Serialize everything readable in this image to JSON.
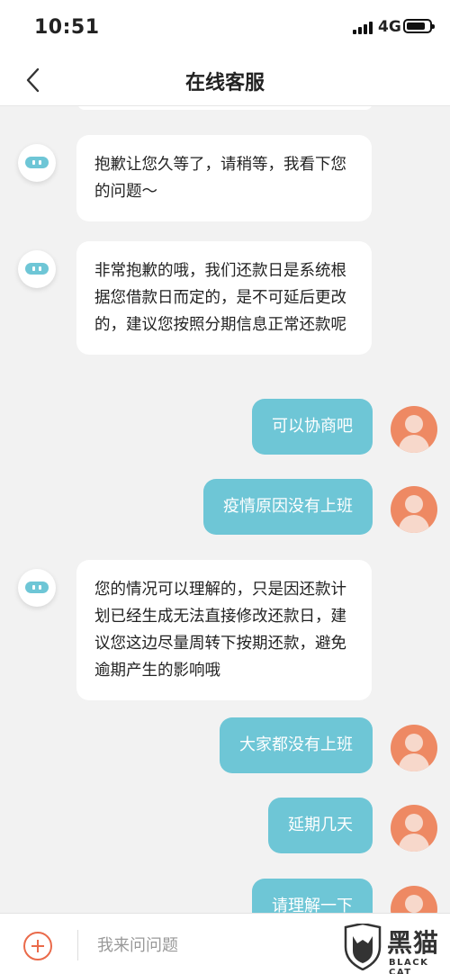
{
  "status_bar": {
    "time": "10:51",
    "network": "4G"
  },
  "header": {
    "title": "在线客服"
  },
  "messages": [
    {
      "from": "agent",
      "text": "抱歉让您久等了，请稍等，我看下您的问题～"
    },
    {
      "from": "agent",
      "text": "非常抱歉的哦，我们还款日是系统根据您借款日而定的，是不可延后更改的，建议您按照分期信息正常还款呢"
    },
    {
      "from": "user",
      "text": "可以协商吧"
    },
    {
      "from": "user",
      "text": "疫情原因没有上班"
    },
    {
      "from": "agent",
      "text": "您的情况可以理解的，只是因还款计划已经生成无法直接修改还款日，建议您这边尽量周转下按期还款，避免逾期产生的影响哦"
    },
    {
      "from": "user",
      "text": "大家都没有上班"
    },
    {
      "from": "user",
      "text": "延期几天"
    },
    {
      "from": "user",
      "text": "请理解一下"
    }
  ],
  "composer": {
    "placeholder": "我来问问题"
  },
  "watermark": {
    "cn": "黑猫",
    "en": "BLACK CAT"
  },
  "colors": {
    "user_bubble": "#6ec6d6",
    "agent_bubble": "#ffffff",
    "user_avatar": "#ee8963",
    "accent": "#ea6a4a"
  },
  "icons": {
    "back": "chevron-left-icon",
    "add": "plus-circle-icon",
    "agent_avatar": "bot-avatar-icon",
    "user_avatar": "user-avatar-icon"
  }
}
